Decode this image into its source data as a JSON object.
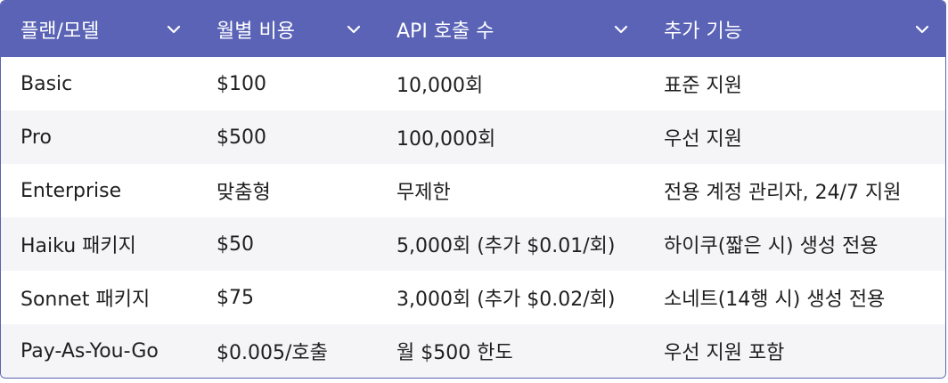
{
  "table": {
    "headers": [
      "플랜/모델",
      "월별 비용",
      "API 호출 수",
      "추가 기능"
    ],
    "rows": [
      [
        "Basic",
        "$100",
        "10,000회",
        "표준 지원"
      ],
      [
        "Pro",
        "$500",
        "100,000회",
        "우선 지원"
      ],
      [
        "Enterprise",
        "맞춤형",
        "무제한",
        "전용 계정 관리자, 24/7 지원"
      ],
      [
        "Haiku 패키지",
        "$50",
        "5,000회 (추가 $0.01/회)",
        "하이쿠(짧은 시) 생성 전용"
      ],
      [
        "Sonnet 패키지",
        "$75",
        "3,000회 (추가 $0.02/회)",
        "소네트(14행 시) 생성 전용"
      ],
      [
        "Pay-As-You-Go",
        "$0.005/호출",
        "월 $500 한도",
        "우선 지원 포함"
      ]
    ],
    "header_icon": "chevron-down-icon",
    "colors": {
      "header_bg": "#5a63b6",
      "header_text": "#ffffff",
      "stripe": "#f5f5f7",
      "border": "#5b63b4"
    }
  }
}
